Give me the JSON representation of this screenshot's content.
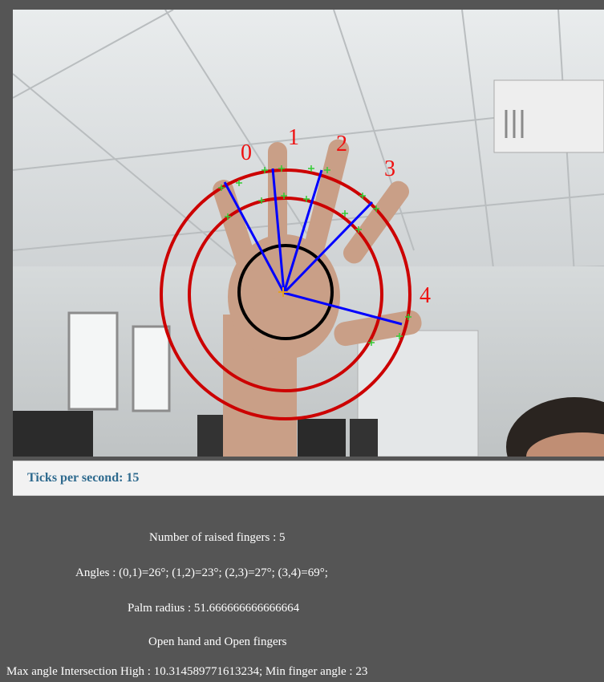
{
  "ticks": {
    "label": "Ticks per second:",
    "value": "15"
  },
  "finger_labels": [
    "0",
    "1",
    "2",
    "3",
    "4"
  ],
  "results": {
    "raised_fingers": "Number of raised fingers : 5",
    "angles": "Angles : (0,1)=26°; (1,2)=23°; (2,3)=27°; (3,4)=69°;",
    "palm_radius": "Palm radius : 51.666666666666664",
    "hand_state": "Open hand and Open fingers",
    "max_angle": "Max angle Intersection High : 10.314589771613234; Min finger angle : 23"
  },
  "colors": {
    "background": "#555555",
    "ticks_bar": "#f2f2f2",
    "ticks_text": "#2e6a8e",
    "circle_outer": "#cc0000",
    "palm_circle": "#000000",
    "finger_lines": "#0000ff",
    "finger_points": "#33cc33",
    "label_text": "#ee1111"
  }
}
